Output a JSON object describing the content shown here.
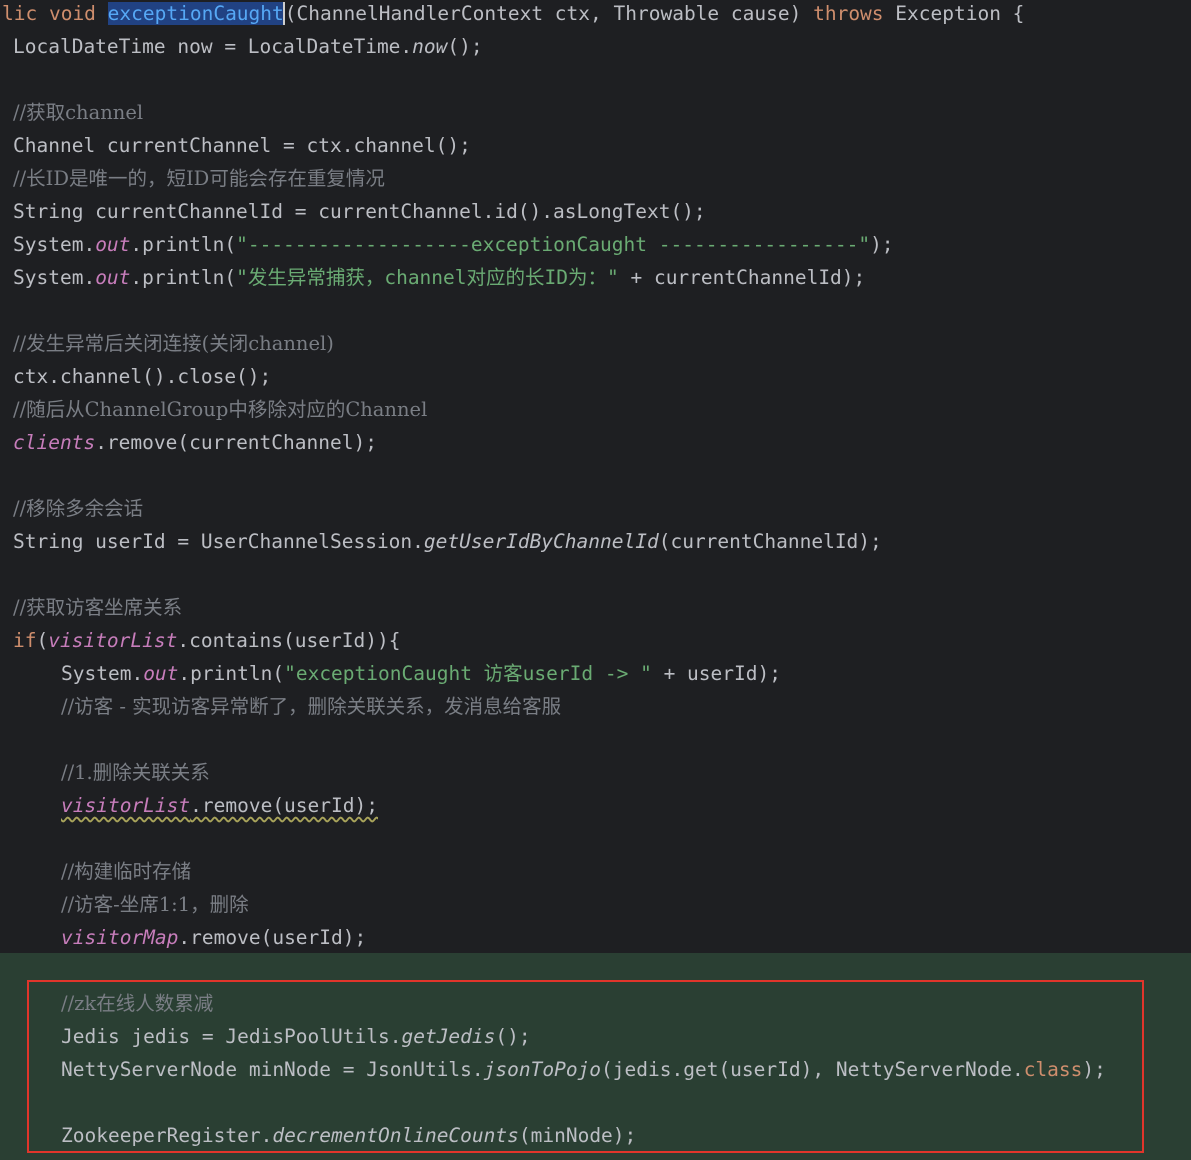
{
  "editor": {
    "highlight_color": "#2a3f33",
    "annotation_color": "#e0352b",
    "selection_color": "#214283",
    "lines": {
      "l01": {
        "kw1": "lic void ",
        "sel": "exceptionCaught",
        "rest": "(ChannelHandlerContext ctx, Throwable cause) ",
        "kw2": "throws",
        "tail": " Exception {"
      },
      "l02": {
        "a": "LocalDateTime now = LocalDateTime.",
        "b": "now",
        "c": "();"
      },
      "l04": {
        "cm": "//获取channel"
      },
      "l05": {
        "a": "Channel currentChannel = ctx.channel();"
      },
      "l06": {
        "cm": "//长ID是唯一的，短ID可能会存在重复情况"
      },
      "l07": {
        "a": "String currentChannelId = currentChannel.id().asLongText();"
      },
      "l08": {
        "a": "System.",
        "f": "out",
        "b": ".println(",
        "s": "\"-------------------exceptionCaught -----------------\"",
        "c": ");"
      },
      "l09": {
        "a": "System.",
        "f": "out",
        "b": ".println(",
        "s": "\"发生异常捕获，channel对应的长ID为：\"",
        "c": " + currentChannelId);"
      },
      "l11": {
        "cm": "//发生异常后关闭连接(关闭channel)"
      },
      "l12": {
        "a": "ctx.channel().close();"
      },
      "l13": {
        "cm": "//随后从ChannelGroup中移除对应的Channel"
      },
      "l14": {
        "f": "clients",
        "a": ".remove(currentChannel);"
      },
      "l16": {
        "cm": "//移除多余会话"
      },
      "l17": {
        "a": "String userId = UserChannelSession.",
        "b": "getUserIdByChannelId",
        "c": "(currentChannelId);"
      },
      "l19": {
        "cm": "//获取访客坐席关系"
      },
      "l20": {
        "kw": "if",
        "a": "(",
        "f": "visitorList",
        "b": ".contains(userId)){"
      },
      "l21": {
        "a": "System.",
        "f": "out",
        "b": ".println(",
        "s": "\"exceptionCaught 访客userId -> \"",
        "c": " + userId);"
      },
      "l22": {
        "cm": "//访客 - 实现访客异常断了，删除关联关系，发消息给客服"
      },
      "l24": {
        "cm": "//1.删除关联关系"
      },
      "l25": {
        "f": "visitorList",
        "a": ".remove(userId);"
      },
      "l27": {
        "cm": "//构建临时存储"
      },
      "l28": {
        "cm": "//访客-坐席1:1，删除"
      },
      "l29": {
        "f": "visitorMap",
        "a": ".remove(userId);"
      },
      "l31": {
        "cm": "//zk在线人数累减"
      },
      "l32": {
        "a": "Jedis jedis = JedisPoolUtils.",
        "b": "getJedis",
        "c": "();"
      },
      "l33": {
        "a": "NettyServerNode minNode = JsonUtils.",
        "b": "jsonToPojo",
        "c": "(jedis.get(userId), NettyServerNode.",
        "kw": "class",
        "d": ");"
      },
      "l35": {
        "a": "ZookeeperRegister.",
        "b": "decrementOnlineCounts",
        "c": "(minNode);"
      }
    }
  }
}
